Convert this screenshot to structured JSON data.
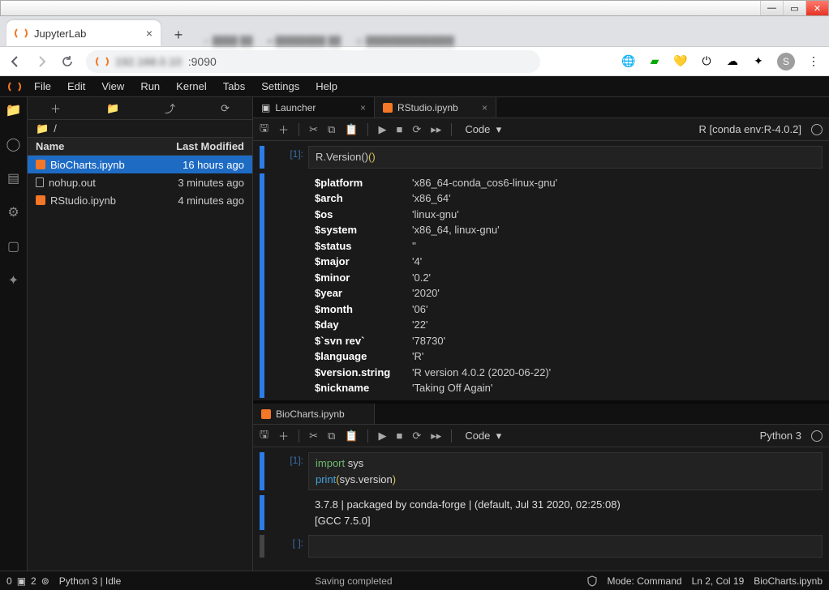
{
  "browser": {
    "tab_title": "JupyterLab",
    "url": ":9090",
    "avatar_letter": "S"
  },
  "menubar": {
    "items": [
      "File",
      "Edit",
      "View",
      "Run",
      "Kernel",
      "Tabs",
      "Settings",
      "Help"
    ]
  },
  "filebrowser": {
    "crumb_icon": "📁",
    "crumb": "/",
    "header_name": "Name",
    "header_mod": "Last Modified",
    "items": [
      {
        "name": "BioCharts.ipynb",
        "mod": "16 hours ago",
        "type": "nb",
        "selected": true
      },
      {
        "name": "nohup.out",
        "mod": "3 minutes ago",
        "type": "file",
        "selected": false
      },
      {
        "name": "RStudio.ipynb",
        "mod": "4 minutes ago",
        "type": "nb",
        "selected": false
      }
    ]
  },
  "top_panel": {
    "tabs": [
      {
        "label": "Launcher",
        "icon": "launcher",
        "active": false,
        "close": "×"
      },
      {
        "label": "RStudio.ipynb",
        "icon": "nb",
        "active": true,
        "close": "×"
      }
    ],
    "toolbar": {
      "celltype": "Code",
      "kernel": "R [conda env:R-4.0.2]"
    },
    "code_prompt": "[1]:",
    "code": "R.Version()",
    "output": [
      {
        "k": "$platform",
        "v": "'x86_64-conda_cos6-linux-gnu'"
      },
      {
        "k": "$arch",
        "v": "'x86_64'"
      },
      {
        "k": "$os",
        "v": "'linux-gnu'"
      },
      {
        "k": "$system",
        "v": "'x86_64, linux-gnu'"
      },
      {
        "k": "$status",
        "v": "''"
      },
      {
        "k": "$major",
        "v": "'4'"
      },
      {
        "k": "$minor",
        "v": "'0.2'"
      },
      {
        "k": "$year",
        "v": "'2020'"
      },
      {
        "k": "$month",
        "v": "'06'"
      },
      {
        "k": "$day",
        "v": "'22'"
      },
      {
        "k": "$`svn rev`",
        "v": "'78730'"
      },
      {
        "k": "$language",
        "v": "'R'"
      },
      {
        "k": "$version.string",
        "v": "'R version 4.0.2 (2020-06-22)'"
      },
      {
        "k": "$nickname",
        "v": "'Taking Off Again'"
      }
    ]
  },
  "bot_panel": {
    "tab_label": "BioCharts.ipynb",
    "toolbar": {
      "celltype": "Code",
      "kernel": "Python 3"
    },
    "code_prompt": "[1]:",
    "code_l1_kw": "import",
    "code_l1_rest": " sys",
    "code_l2_fn": "print",
    "code_l2_open": "(",
    "code_l2_arg1": "sys",
    "code_l2_dot": ".",
    "code_l2_arg2": "version",
    "code_l2_close": ")",
    "out_l1": "3.7.8 | packaged by conda-forge | (default, Jul 31 2020, 02:25:08)",
    "out_l2": "[GCC 7.5.0]",
    "empty_prompt": "[ ]:"
  },
  "status": {
    "left_a": "0",
    "left_b": "2",
    "kernel": "Python 3 | Idle",
    "center": "Saving completed",
    "mode": "Mode: Command",
    "pos": "Ln 2, Col 19",
    "right": "BioCharts.ipynb"
  }
}
